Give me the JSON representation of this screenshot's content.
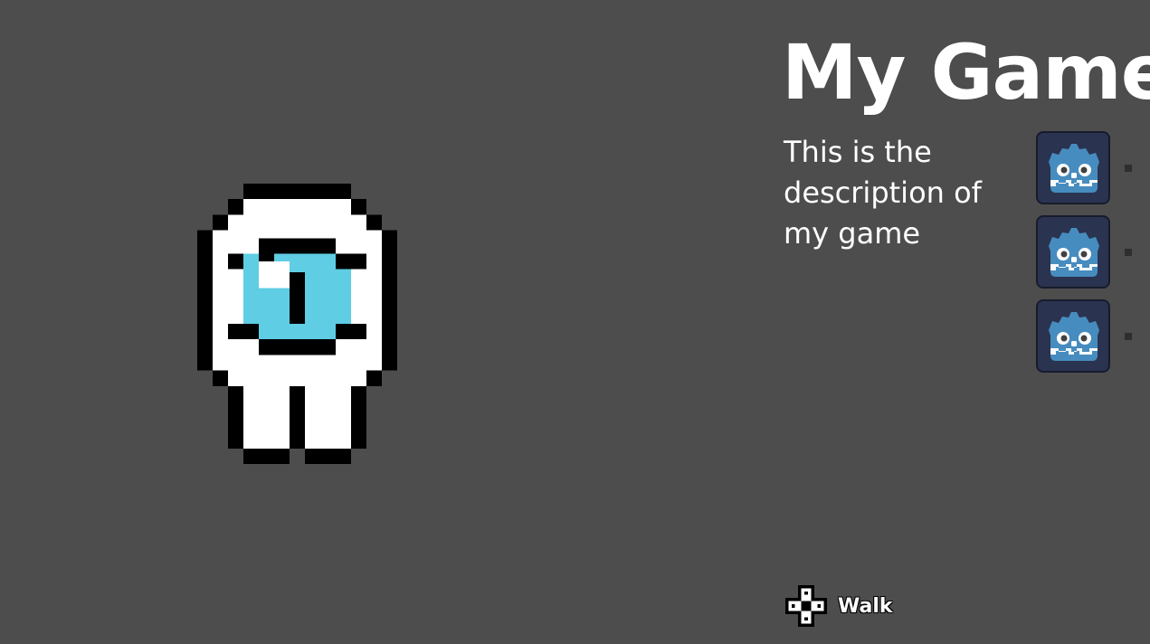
{
  "game": {
    "title": "My Game",
    "description": "This is the description of my game"
  },
  "character": {
    "icon": "cyclops-robot-sprite",
    "colors": {
      "outline": "#000000",
      "body": "#ffffff",
      "eye": "#5fcde4"
    }
  },
  "slots": [
    {
      "icon": "godot-icon"
    },
    {
      "icon": "godot-icon"
    },
    {
      "icon": "godot-icon"
    }
  ],
  "controls": [
    {
      "icon": "dpad-icon",
      "label": "Walk"
    }
  ],
  "colors": {
    "background": "#4d4d4d",
    "slot_fill": "#2a3350",
    "godot_blue": "#478cbf"
  }
}
